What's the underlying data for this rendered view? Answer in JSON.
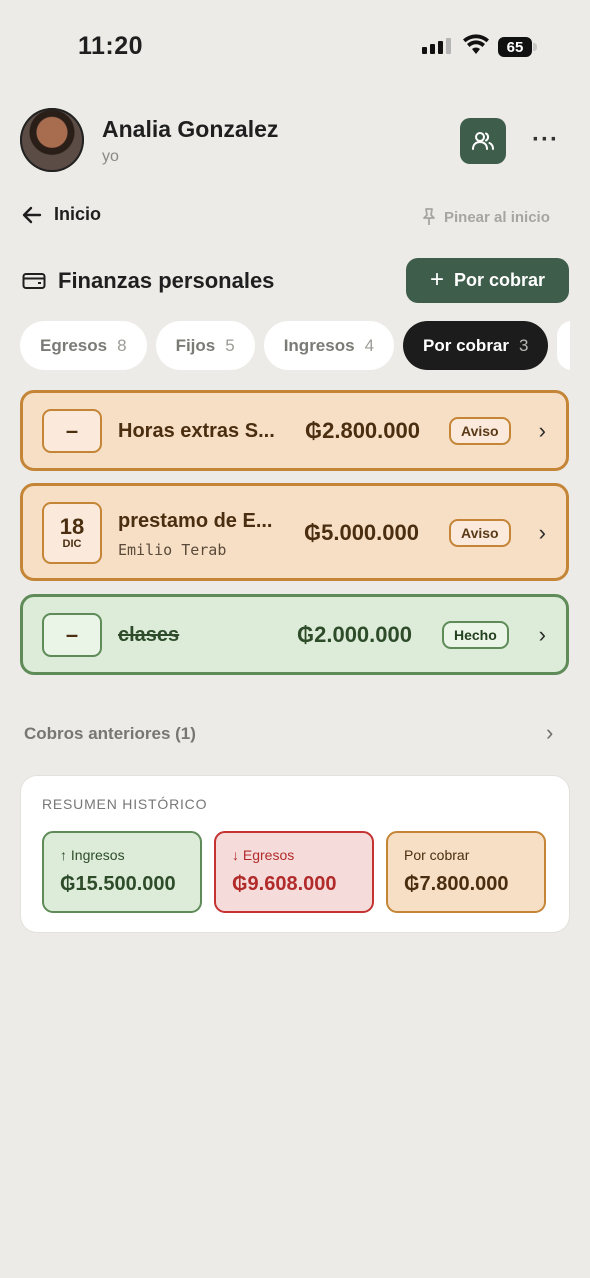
{
  "status_bar": {
    "time": "11:20",
    "battery": "65"
  },
  "header": {
    "name": "Analia Gonzalez",
    "subtitle": "yo",
    "more": "···"
  },
  "nav": {
    "back_label": "Inicio",
    "pin_label": "Pinear al inicio"
  },
  "section": {
    "title": "Finanzas personales",
    "add_button_label": "Por cobrar"
  },
  "tabs": [
    {
      "label": "Egresos",
      "count": "8"
    },
    {
      "label": "Fijos",
      "count": "5"
    },
    {
      "label": "Ingresos",
      "count": "4"
    },
    {
      "label": "Por cobrar",
      "count": "3"
    }
  ],
  "items": [
    {
      "date": "–",
      "title": "Horas extras S...",
      "subtitle": "",
      "amount": "₲2.800.000",
      "badge": "Aviso",
      "status": "warn"
    },
    {
      "day": "18",
      "month": "DIC",
      "title": "prestamo de E...",
      "subtitle": "Emilio Terab",
      "amount": "₲5.000.000",
      "badge": "Aviso",
      "status": "warn"
    },
    {
      "date": "–",
      "title": "clases",
      "subtitle": "",
      "amount": "₲2.000.000",
      "badge": "Hecho",
      "status": "done"
    }
  ],
  "previous": {
    "label": "Cobros anteriores (1)"
  },
  "summary": {
    "title": "RESUMEN HISTÓRICO",
    "ingresos": {
      "label": "↑ Ingresos",
      "value": "₲15.500.000"
    },
    "egresos": {
      "label": "↓ Egresos",
      "value": "₲9.608.000"
    },
    "por_cobrar": {
      "label": "Por cobrar",
      "value": "₲7.800.000"
    }
  },
  "icons": {
    "signal": "signal-icon",
    "wifi": "wifi-icon",
    "people": "people-icon",
    "back": "arrow-left-icon",
    "pin": "pin-icon",
    "wallet": "wallet-icon",
    "chevron": "chevron-right-icon"
  },
  "colors": {
    "accent_green": "#3e5d4b",
    "warn": "#c58537",
    "done": "#5f8b59",
    "danger": "#c43232"
  }
}
